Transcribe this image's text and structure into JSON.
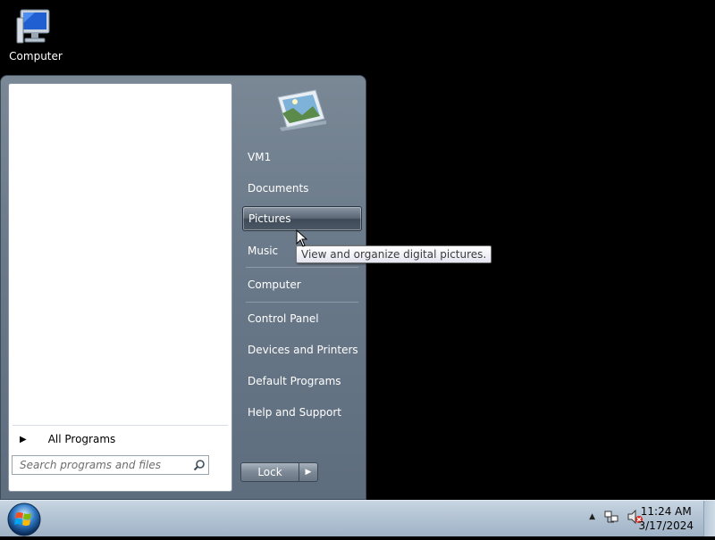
{
  "desktop": {
    "icons": [
      {
        "label": "Computer",
        "icon": "computer-icon"
      }
    ]
  },
  "start_menu": {
    "left_pane": {
      "all_programs_label": "All Programs",
      "search_placeholder": "Search programs and files"
    },
    "right_pane": {
      "user_picture": "landscape-user-icon",
      "items": [
        {
          "label": "VM1"
        },
        {
          "label": "Documents"
        },
        {
          "label": "Pictures",
          "hovered": true
        },
        {
          "label": "Music"
        },
        {
          "label": "Computer"
        },
        {
          "label": "Control Panel"
        },
        {
          "label": "Devices and Printers"
        },
        {
          "label": "Default Programs"
        },
        {
          "label": "Help and Support"
        }
      ],
      "shutdown_label": "Lock"
    }
  },
  "tooltip": {
    "text": "View and organize digital pictures."
  },
  "taskbar": {
    "start_orb": "windows-orb-icon",
    "tray_icons": [
      "show-hidden-icons-arrow",
      "network-icon",
      "volume-muted-icon"
    ],
    "clock": {
      "time": "11:24 AM",
      "date": "3/17/2024"
    }
  }
}
